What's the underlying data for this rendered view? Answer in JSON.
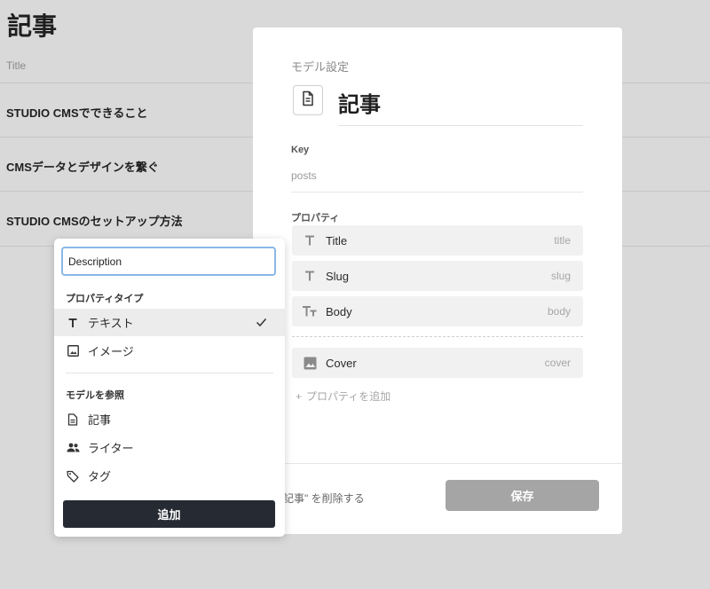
{
  "page": {
    "title": "記事",
    "column_header": "Title",
    "rows": [
      "STUDIO CMSでできること",
      "CMSデータとデザインを繋ぐ",
      "STUDIO CMSのセットアップ方法"
    ]
  },
  "modal": {
    "heading": "モデル設定",
    "model_icon": "document-icon",
    "model_name": "記事",
    "key_label": "Key",
    "key_value": "posts",
    "properties_label": "プロパティ",
    "properties": [
      {
        "name": "Title",
        "key": "title",
        "icon": "text-T-icon"
      },
      {
        "name": "Slug",
        "key": "slug",
        "icon": "text-T-icon"
      },
      {
        "name": "Body",
        "key": "body",
        "icon": "rich-text-icon"
      },
      {
        "name": "Cover",
        "key": "cover",
        "icon": "image-icon"
      }
    ],
    "add_property_label": "プロパティを追加",
    "delete_label": "記事\" を削除する",
    "save_label": "保存"
  },
  "popover": {
    "input_value": "Description",
    "type_section_label": "プロパティタイプ",
    "types": [
      {
        "label": "テキスト",
        "icon": "text-T-icon",
        "selected": true
      },
      {
        "label": "イメージ",
        "icon": "image-icon",
        "selected": false
      }
    ],
    "ref_section_label": "モデルを参照",
    "refs": [
      {
        "label": "記事",
        "icon": "document-icon"
      },
      {
        "label": "ライター",
        "icon": "people-icon"
      },
      {
        "label": "タグ",
        "icon": "tag-icon"
      }
    ],
    "add_button_label": "追加"
  },
  "colors": {
    "accent_focus": "#8ab8e6",
    "primary_button": "#262a33",
    "disabled_button": "#a5a5a5"
  }
}
